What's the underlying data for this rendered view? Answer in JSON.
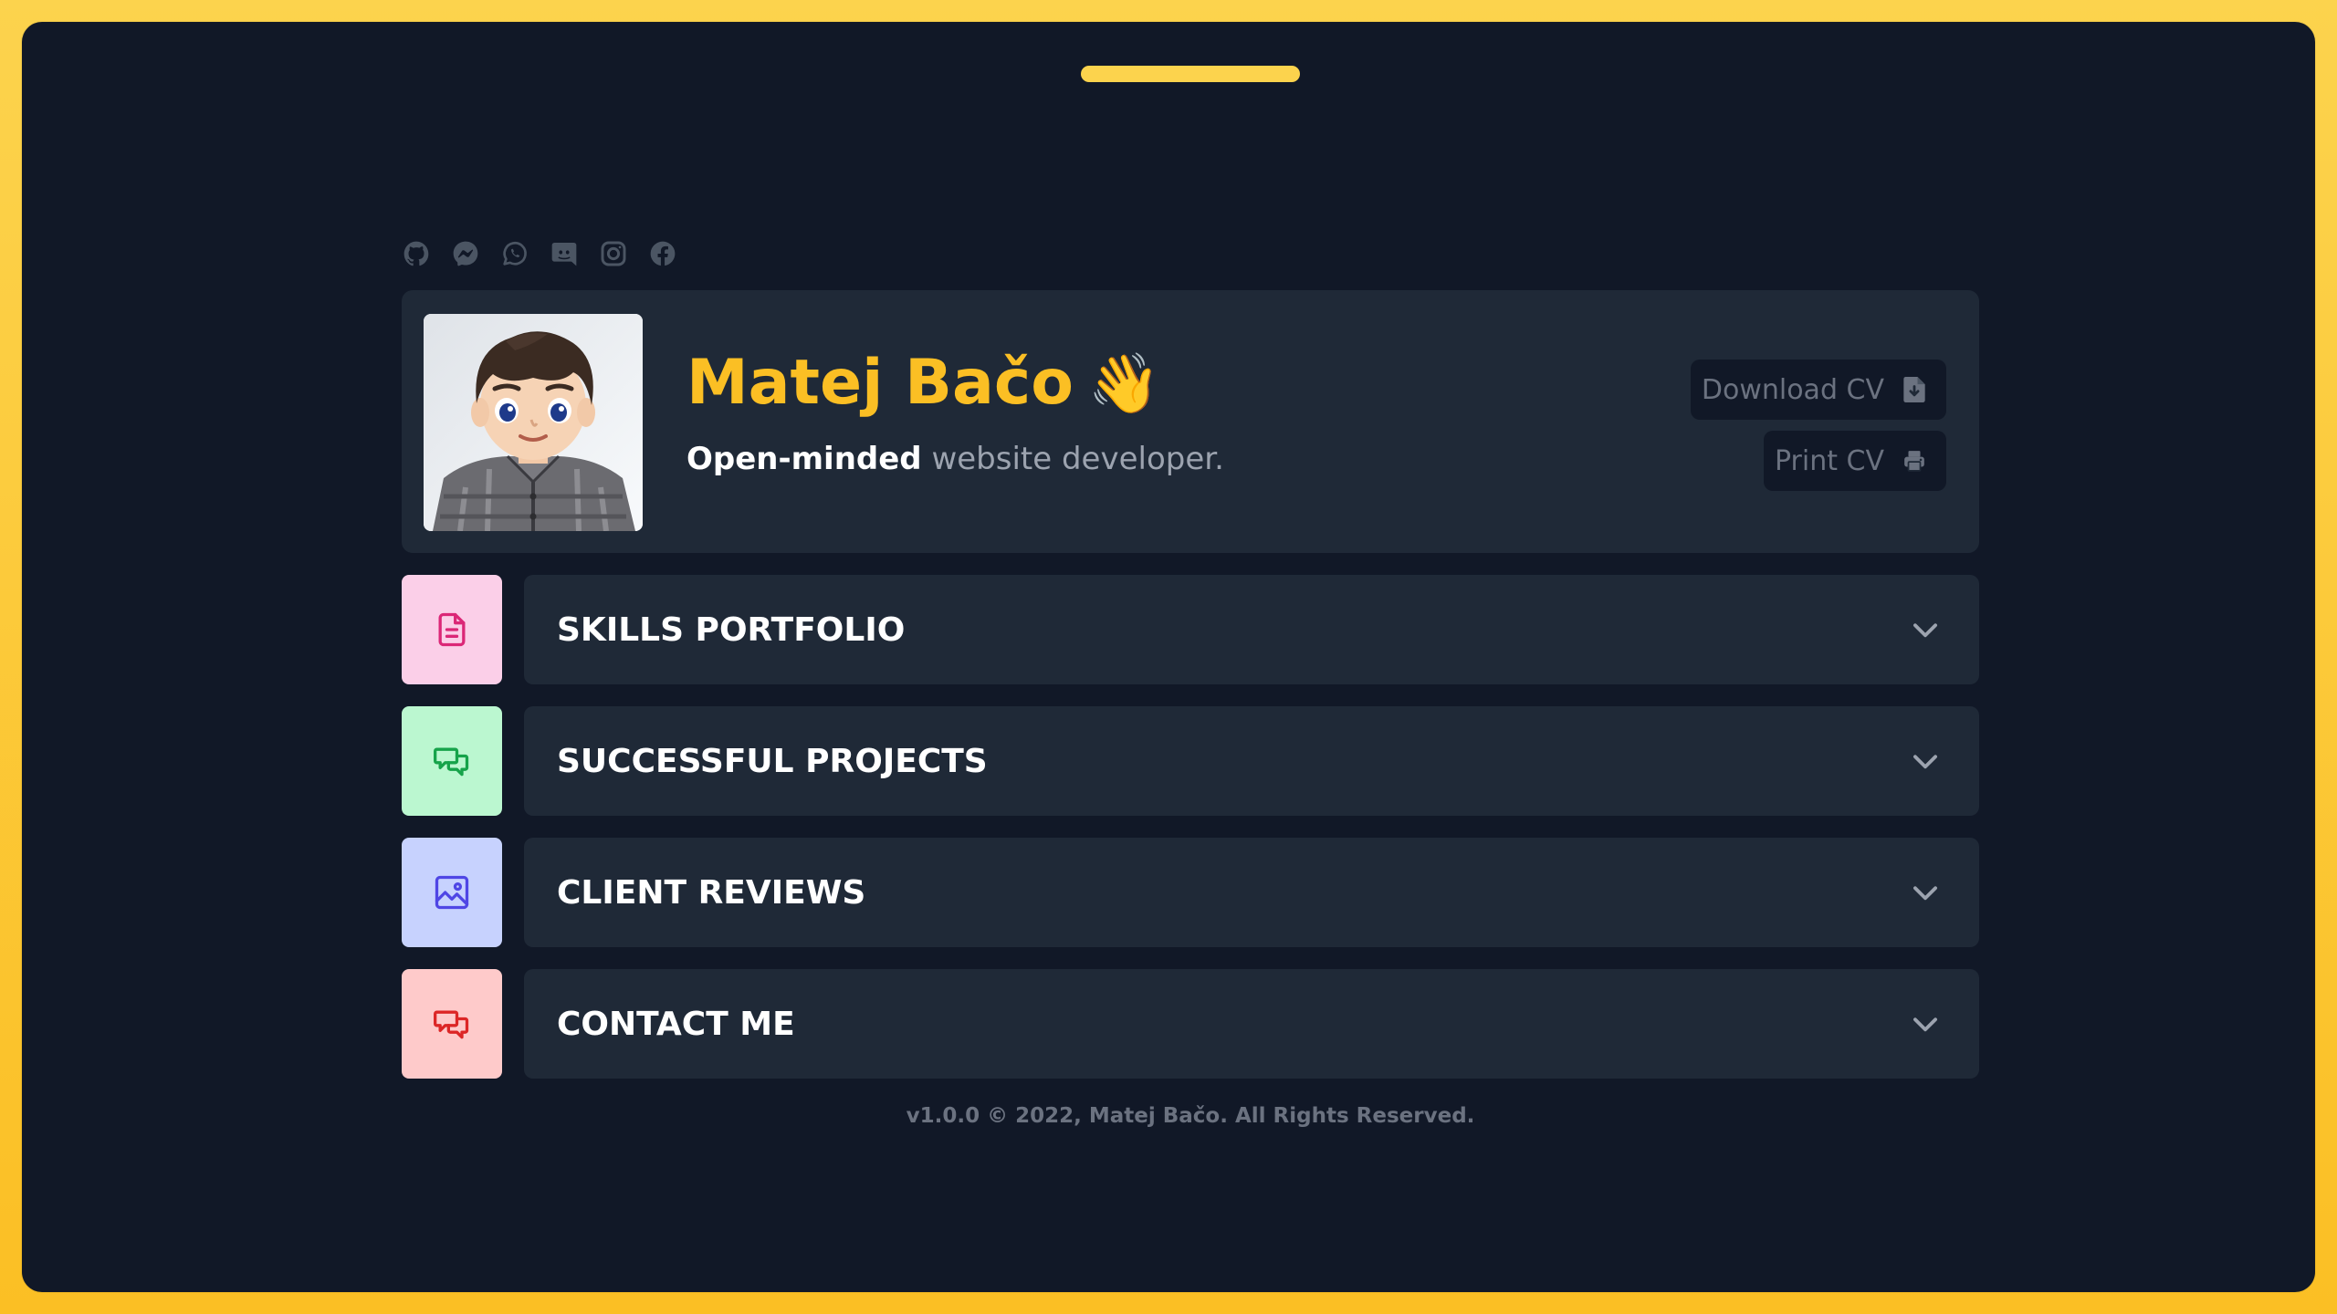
{
  "social_links": [
    {
      "icon": "github-icon"
    },
    {
      "icon": "messenger-icon"
    },
    {
      "icon": "whatsapp-icon"
    },
    {
      "icon": "discord-icon"
    },
    {
      "icon": "instagram-icon"
    },
    {
      "icon": "facebook-icon"
    }
  ],
  "profile": {
    "name": "Matej Bačo",
    "wave": "👋",
    "tagline_strong": "Open-minded",
    "tagline_rest": " website developer.",
    "download_label": "Download CV",
    "print_label": "Print CV"
  },
  "sections": [
    {
      "title": "SKILLS PORTFOLIO",
      "icon": "document-icon",
      "tile_color": "#fbcfe8",
      "icon_color": "#db2777"
    },
    {
      "title": "SUCCESSFUL PROJECTS",
      "icon": "chat-icon",
      "tile_color": "#bbf7d0",
      "icon_color": "#16a34a"
    },
    {
      "title": "CLIENT REVIEWS",
      "icon": "image-icon",
      "tile_color": "#c7d2fe",
      "icon_color": "#4f46e5"
    },
    {
      "title": "CONTACT ME",
      "icon": "chat-icon",
      "tile_color": "#fecaca",
      "icon_color": "#dc2626"
    }
  ],
  "footer": "v1.0.0 © 2022, Matej Bačo. All Rights Reserved.",
  "colors": {
    "frame_border": "#fcd34d",
    "background": "#111827",
    "card": "#1f2937",
    "accent": "#fbbf24",
    "muted": "#6b7280"
  }
}
